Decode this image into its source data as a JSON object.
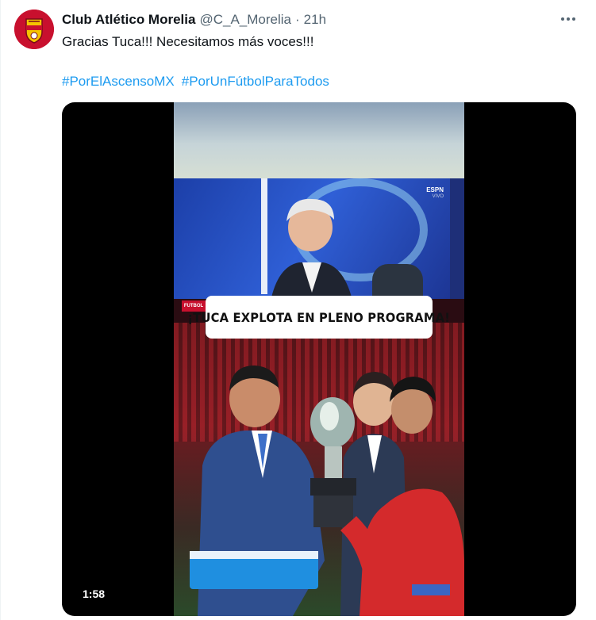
{
  "tweet": {
    "author_name": "Club Atlético Morelia",
    "handle": "@C_A_Morelia",
    "separator": "·",
    "time": "21h",
    "text": "Gracias Tuca!!! Necesitamos más voces!!!",
    "hashtags": [
      "#PorElAscensoMX",
      "#PorUnFútbolParaTodos"
    ],
    "more_icon": "more-horizontal-icon"
  },
  "video": {
    "caption": "¡TUCA EXPLOTA EN PLENO PROGRAMA!",
    "duration": "1:58",
    "broadcaster": "ESPN",
    "broadcaster_sub": "VIVO",
    "tag": "FUTBOL"
  },
  "colors": {
    "link": "#1d9bf0",
    "text": "#0f1419",
    "muted": "#536471",
    "club_red": "#c8102e",
    "club_yellow": "#f5c400"
  }
}
